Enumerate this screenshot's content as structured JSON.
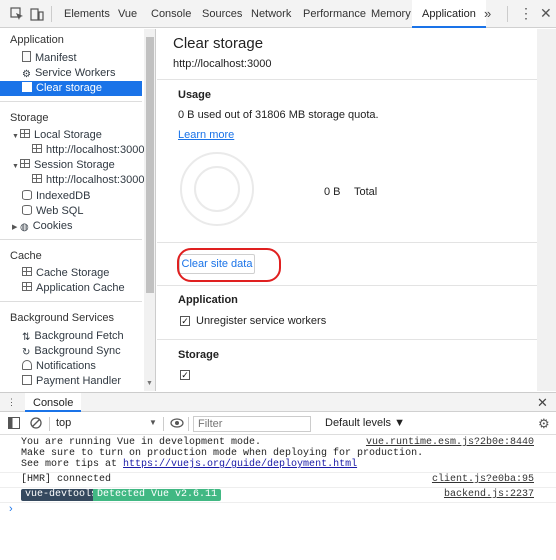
{
  "topbar": {
    "tabs": [
      "Elements",
      "Vue",
      "Console",
      "Sources",
      "Network",
      "Performance",
      "Memory",
      "Application"
    ],
    "active_tab": "Application",
    "more": "»",
    "kebab": "⋮",
    "close": "✕"
  },
  "sidebar": {
    "application_head": "Application",
    "manifest": "Manifest",
    "service_workers": "Service Workers",
    "clear_storage": "Clear storage",
    "storage_head": "Storage",
    "local_storage": "Local Storage",
    "local_origin": "http://localhost:3000",
    "session_storage": "Session Storage",
    "session_origin": "http://localhost:3000",
    "indexeddb": "IndexedDB",
    "websql": "Web SQL",
    "cookies": "Cookies",
    "cache_head": "Cache",
    "cache_storage": "Cache Storage",
    "application_cache": "Application Cache",
    "bg_head": "Background Services",
    "bg_fetch": "Background Fetch",
    "bg_sync": "Background Sync",
    "notifications": "Notifications",
    "payment_handler": "Payment Handler"
  },
  "main": {
    "title": "Clear storage",
    "origin": "http://localhost:3000",
    "usage_head": "Usage",
    "usage_text": "0 B used out of 31806 MB storage quota.",
    "learn_more": "Learn more",
    "usage_value": "0 B",
    "usage_total": "Total",
    "clear_button": "Clear site data",
    "application_head": "Application",
    "unregister_label": "Unregister service workers",
    "unregister_checked": true,
    "storage_head": "Storage"
  },
  "drawer": {
    "tab": "Console",
    "close": "✕",
    "context": "top",
    "filter_placeholder": "Filter",
    "levels": "Default levels ▼"
  },
  "console": {
    "msg1_line1": "You are running Vue in development mode.",
    "msg1_line2": "Make sure to turn on production mode when deploying for production.",
    "msg1_line3_prefix": "See more tips at ",
    "msg1_link": "https://vuejs.org/guide/deployment.html",
    "msg1_src": "vue.runtime.esm.js?2b0e:8440",
    "msg2": "[HMR] connected",
    "msg2_src": "client.js?e0ba:95",
    "badge_left": "vue-devtools",
    "badge_right": "Detected Vue v2.6.11",
    "msg3_src": "backend.js:2237",
    "prompt": "›"
  },
  "colors": {
    "accent": "#1a73e8",
    "annotation_circle": "#e02020",
    "vue_dark": "#35495e",
    "vue_green": "#41b883"
  }
}
